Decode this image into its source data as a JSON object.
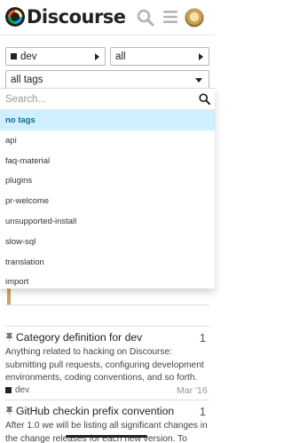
{
  "header": {
    "logo_text": "Discourse"
  },
  "filters": {
    "category": "dev",
    "period": "all",
    "tags": "all tags"
  },
  "tag_dropdown": {
    "search_placeholder": "Search...",
    "items": [
      {
        "label": "no tags",
        "active": true
      },
      {
        "label": "api"
      },
      {
        "label": "faq-material"
      },
      {
        "label": "plugins"
      },
      {
        "label": "pr-welcome"
      },
      {
        "label": "unsupported-install"
      },
      {
        "label": "slow-sql"
      },
      {
        "label": "translation"
      },
      {
        "label": "import"
      }
    ]
  },
  "topics": [
    {
      "title": "Category definition for dev",
      "replies": "1",
      "excerpt": "Anything related to hacking on Discourse: submitting pull requests, configuring development environments, coding conventions, and so forth.",
      "category": "dev",
      "date": "Mar '16"
    },
    {
      "title": "GitHub checkin prefix convention",
      "replies": "1",
      "excerpt": "After 1.0 we will be listing all significant changes in the change releases for each new version. To"
    }
  ],
  "colors": {
    "active_tag_bg": "#d1f0ff",
    "active_tag_text": "#0a6d8c",
    "category_dev": "#222222"
  }
}
